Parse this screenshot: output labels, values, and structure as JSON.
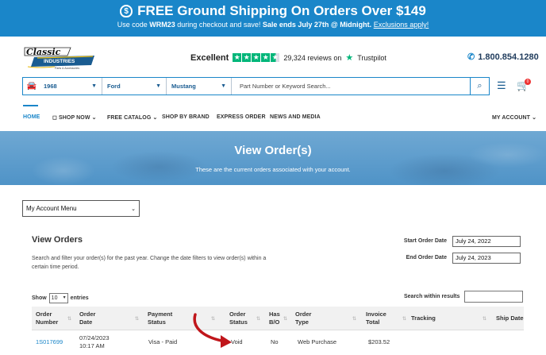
{
  "promo": {
    "headline": "FREE Ground Shipping On Orders Over $149",
    "line_pre": "Use code ",
    "code": "WRM23",
    "line_mid": " during checkout and save! ",
    "sale_ends": "Sale ends July 27th @ Midnight.",
    "exclusions_link": "Exclusions apply!",
    "icon": "dollar-bag-icon"
  },
  "header": {
    "logo_line1": "Classic",
    "logo_line2": "INDUSTRIES",
    "logo_line3": "Parts & Accessories",
    "rating_word": "Excellent",
    "reviews_text": "29,324 reviews on",
    "trustpilot": "Trustpilot",
    "phone": "1.800.854.1280"
  },
  "search": {
    "year": "1968",
    "make": "Ford",
    "model": "Mustang",
    "placeholder": "Part Number or Keyword Search..."
  },
  "nav": {
    "home": "HOME",
    "shop_now": "SHOP NOW",
    "free_catalog": "FREE CATALOG",
    "shop_by_brand": "SHOP BY BRAND",
    "express_order": "EXPRESS ORDER",
    "news_and_media": "NEWS AND MEDIA",
    "my_account": "MY ACCOUNT"
  },
  "hero": {
    "title": "View Order(s)",
    "subtitle": "These are the current orders associated with your account."
  },
  "account_menu": {
    "selected": "My Account Menu"
  },
  "view_orders": {
    "title": "View Orders",
    "description": "Search and filter your order(s) for the past year. Change the date filters to view order(s) within a certain time period.",
    "start_label": "Start Order Date",
    "start_value": "July 24, 2022",
    "end_label": "End Order Date",
    "end_value": "July 24, 2023",
    "show_label": "Show",
    "show_value": "10",
    "entries_label": "entries",
    "search_within_label": "Search within results"
  },
  "table": {
    "headers": [
      {
        "l1": "Order",
        "l2": "Number"
      },
      {
        "l1": "Order",
        "l2": "Date"
      },
      {
        "l1": "Payment",
        "l2": "Status"
      },
      {
        "l1": "Order",
        "l2": "Status"
      },
      {
        "l1": "Has",
        "l2": "B/O"
      },
      {
        "l1": "Order",
        "l2": "Type"
      },
      {
        "l1": "Invoice",
        "l2": "Total"
      },
      {
        "l1": "Tracking",
        "l2": ""
      },
      {
        "l1": "Ship Date",
        "l2": ""
      }
    ],
    "rows": [
      {
        "order_number": "1S017699",
        "order_date": "07/24/2023",
        "order_time": "10:17 AM",
        "payment_status": "Visa - Paid",
        "order_status": "Void",
        "has_bo": "No",
        "order_type": "Web Purchase",
        "invoice_total": "$203.52"
      }
    ]
  },
  "colors": {
    "brand_blue": "#1a86c9",
    "annotation_red": "#c0161b"
  }
}
